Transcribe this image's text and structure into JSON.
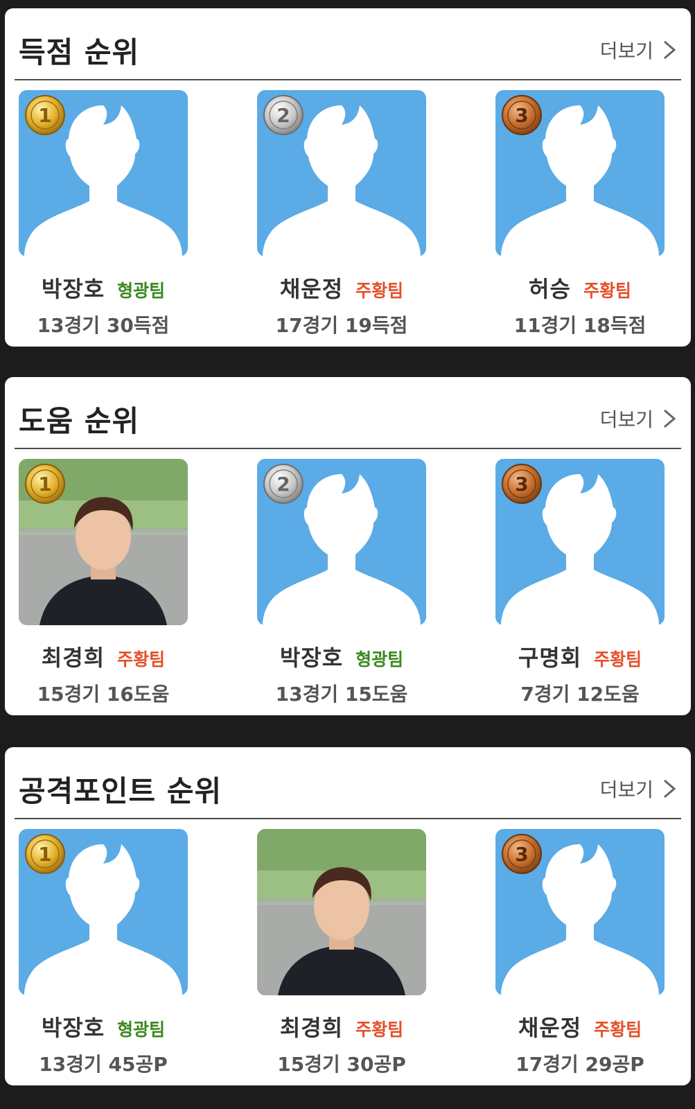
{
  "sections": [
    {
      "title": "득점 순위",
      "more": "더보기",
      "players": [
        {
          "rank": "1",
          "name": "박장호",
          "team": "형광팀",
          "team_color": "#3a8a1e",
          "stat": "13경기 30득점",
          "photo": "placeholder"
        },
        {
          "rank": "2",
          "name": "채운정",
          "team": "주황팀",
          "team_color": "#e4502a",
          "stat": "17경기 19득점",
          "photo": "placeholder"
        },
        {
          "rank": "3",
          "name": "허승",
          "team": "주황팀",
          "team_color": "#e4502a",
          "stat": "11경기 18득점",
          "photo": "placeholder"
        }
      ]
    },
    {
      "title": "도움 순위",
      "more": "더보기",
      "players": [
        {
          "rank": "1",
          "name": "최경희",
          "team": "주황팀",
          "team_color": "#e4502a",
          "stat": "15경기 16도움",
          "photo": "real-photo"
        },
        {
          "rank": "2",
          "name": "박장호",
          "team": "형광팀",
          "team_color": "#3a8a1e",
          "stat": "13경기 15도움",
          "photo": "placeholder"
        },
        {
          "rank": "3",
          "name": "구명회",
          "team": "주황팀",
          "team_color": "#e4502a",
          "stat": "7경기 12도움",
          "photo": "placeholder"
        }
      ]
    },
    {
      "title": "공격포인트 순위",
      "more": "더보기",
      "players": [
        {
          "rank": "1",
          "name": "박장호",
          "team": "형광팀",
          "team_color": "#3a8a1e",
          "stat": "13경기 45공P",
          "photo": "placeholder"
        },
        {
          "rank": "",
          "name": "최경희",
          "team": "주황팀",
          "team_color": "#e4502a",
          "stat": "15경기 30공P",
          "photo": "real-photo"
        },
        {
          "rank": "3",
          "name": "채운정",
          "team": "주황팀",
          "team_color": "#e4502a",
          "stat": "17경기 29공P",
          "photo": "placeholder"
        }
      ]
    }
  ],
  "colors": {
    "page_background": "#1c1c1c",
    "card_background": "#ffffff",
    "placeholder_blue": "#5aabe6",
    "team_green": "#3a8a1e",
    "team_orange": "#e4502a",
    "medal_gold": "#d9a520",
    "medal_silver": "#c6c6c6",
    "medal_bronze": "#c46a2c"
  }
}
